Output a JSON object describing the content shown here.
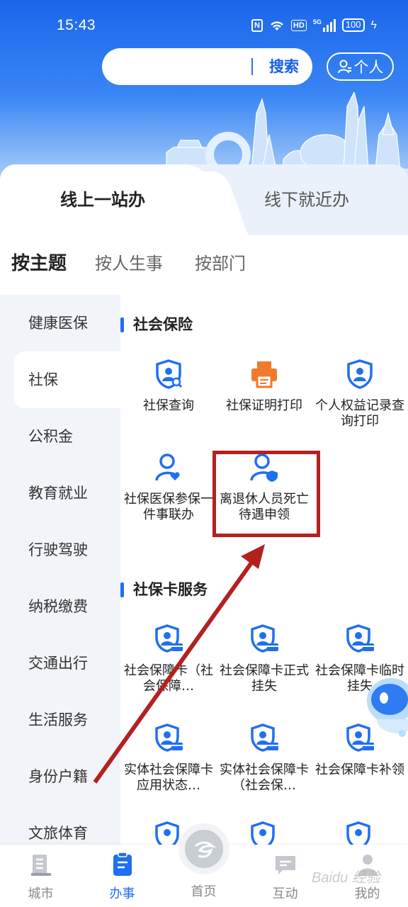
{
  "status_bar": {
    "time": "15:43",
    "nfc": "N",
    "network": "5G",
    "hd": "HD",
    "battery": "100"
  },
  "search": {
    "placeholder": "",
    "button": "搜索"
  },
  "personal": {
    "label": "个人"
  },
  "tabs": [
    {
      "label": "线上一站办",
      "active": true
    },
    {
      "label": "线下就近办",
      "active": false
    }
  ],
  "topics": [
    {
      "label": "按主题",
      "active": true
    },
    {
      "label": "按人生事",
      "active": false
    },
    {
      "label": "按部门",
      "active": false
    }
  ],
  "sidebar": {
    "items": [
      {
        "label": "健康医保"
      },
      {
        "label": "社保",
        "active": true
      },
      {
        "label": "公积金"
      },
      {
        "label": "教育就业"
      },
      {
        "label": "行驶驾驶"
      },
      {
        "label": "纳税缴费"
      },
      {
        "label": "交通出行"
      },
      {
        "label": "生活服务"
      },
      {
        "label": "身份户籍"
      },
      {
        "label": "文旅体育"
      }
    ]
  },
  "sections": [
    {
      "title": "社会保险",
      "services": [
        {
          "label": "社保查询",
          "icon": "shield-search-icon"
        },
        {
          "label": "社保证明打印",
          "icon": "printer-icon"
        },
        {
          "label": "个人权益记录查询打印",
          "icon": "shield-user-icon"
        },
        {
          "label": "社保医保参保一件事联办",
          "icon": "user-heart-icon"
        },
        {
          "label": "离退休人员死亡待遇申领",
          "icon": "user-shield-icon",
          "highlighted": true
        }
      ]
    },
    {
      "title": "社保卡服务",
      "services": [
        {
          "label": "社会保障卡（社会保障…",
          "icon": "shield-card-icon"
        },
        {
          "label": "社会保障卡正式挂失",
          "icon": "shield-card-icon"
        },
        {
          "label": "社会保障卡临时挂失",
          "icon": "shield-card-icon"
        },
        {
          "label": "实体社会保障卡应用状态…",
          "icon": "shield-card-icon"
        },
        {
          "label": "实体社会保障卡（社会保…",
          "icon": "shield-card-icon"
        },
        {
          "label": "社会保障卡补领",
          "icon": "shield-card-icon"
        }
      ]
    }
  ],
  "bottom_nav": [
    {
      "label": "城市",
      "icon": "building-icon"
    },
    {
      "label": "办事",
      "icon": "document-icon",
      "active": true
    },
    {
      "label": "首页",
      "icon": "home-logo-icon"
    },
    {
      "label": "互动",
      "icon": "chat-icon"
    },
    {
      "label": "我的",
      "icon": "user-icon"
    }
  ],
  "watermark": "Baidu 经验",
  "colors": {
    "primary": "#1f6ff0",
    "highlight": "#b3211f",
    "printer": "#f07a2a"
  }
}
